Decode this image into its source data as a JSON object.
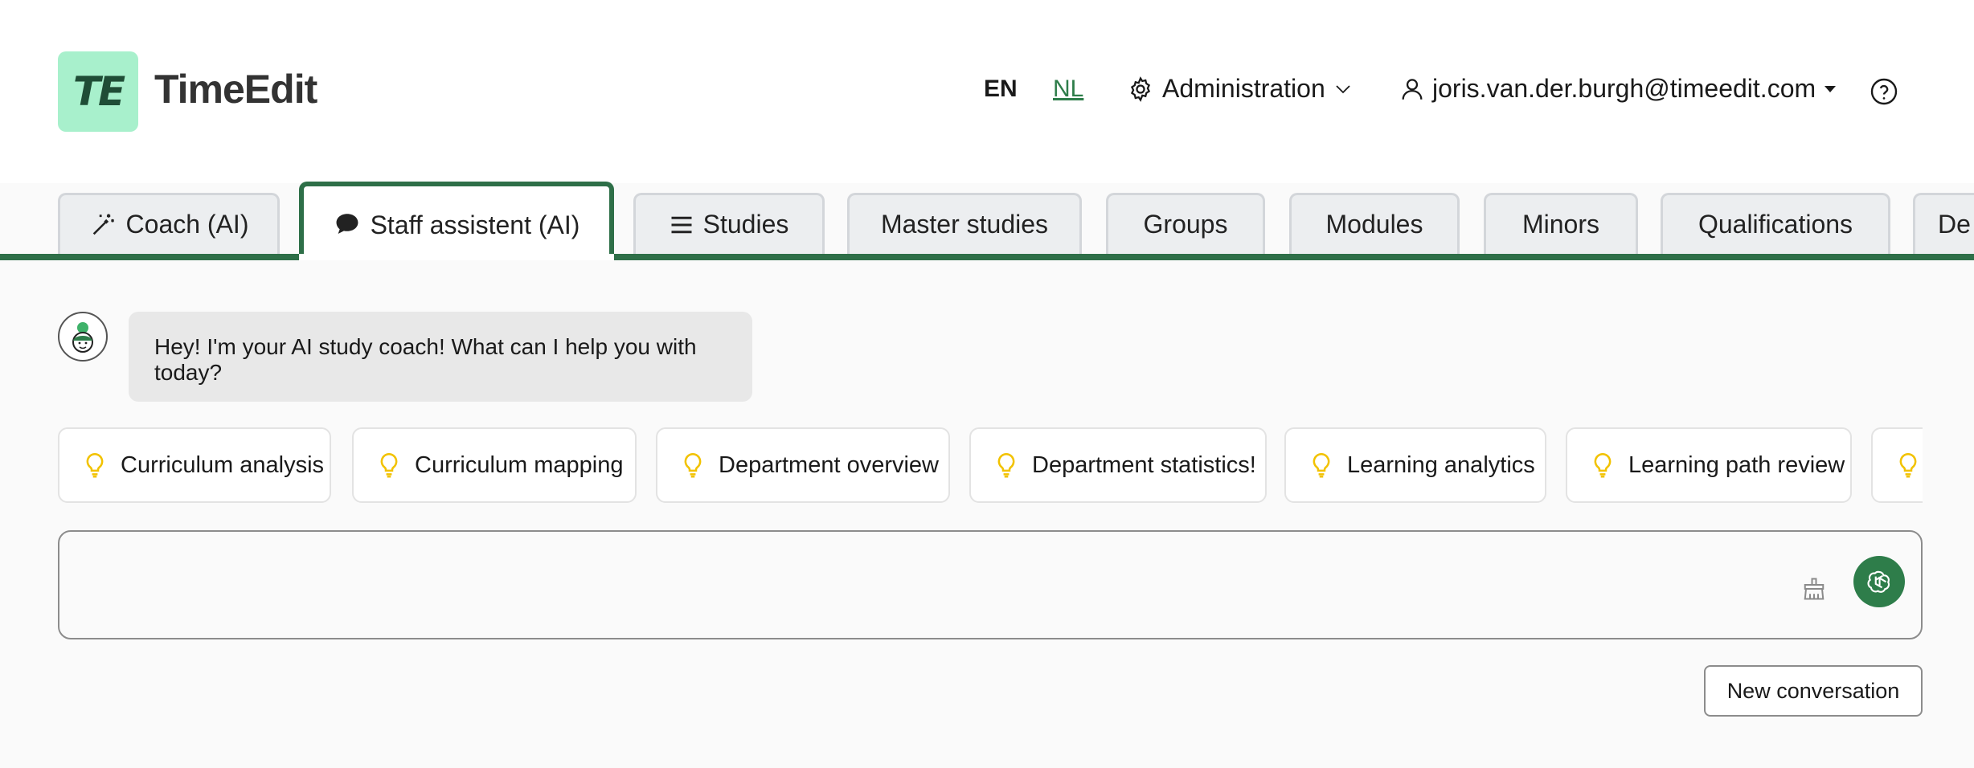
{
  "brand": {
    "logo_text": "TE",
    "name": "TimeEdit"
  },
  "header": {
    "lang_en": "EN",
    "lang_nl": "NL",
    "admin_label": "Administration",
    "user_email": "joris.van.der.burgh@timeedit.com"
  },
  "tabs": [
    {
      "label": "Coach (AI)",
      "icon": "magic-wand-icon",
      "active": false
    },
    {
      "label": "Staff assistent (AI)",
      "icon": "chat-bubble-icon",
      "active": true
    },
    {
      "label": "Studies",
      "icon": "list-icon",
      "active": false
    },
    {
      "label": "Master studies",
      "active": false
    },
    {
      "label": "Groups",
      "active": false
    },
    {
      "label": "Modules",
      "active": false
    },
    {
      "label": "Minors",
      "active": false
    },
    {
      "label": "Qualifications",
      "active": false
    },
    {
      "label": "De",
      "active": false
    }
  ],
  "chat": {
    "greeting": "Hey! I'm your AI study coach! What can I help you with today?"
  },
  "suggestions": [
    "Curriculum analysis",
    "Curriculum mapping",
    "Department overview",
    "Department statistics!",
    "Learning analytics",
    "Learning path review",
    ""
  ],
  "input": {
    "placeholder": ""
  },
  "new_conversation_label": "New conversation",
  "colors": {
    "accent": "#2e6f48",
    "send_button": "#2e7d4a",
    "logo_bg": "#a8f0cc",
    "lightbulb": "#f2c200"
  }
}
